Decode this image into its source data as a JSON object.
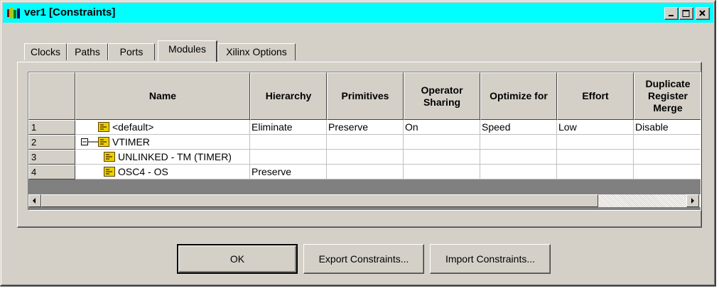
{
  "window": {
    "title": "ver1 [Constraints]"
  },
  "tabs": [
    "Clocks",
    "Paths",
    "Ports",
    "Modules",
    "Xilinx Options"
  ],
  "active_tab": "Modules",
  "table": {
    "columns": [
      "Name",
      "Hierarchy",
      "Primitives",
      "Operator Sharing",
      "Optimize for",
      "Effort",
      "Duplicate Register Merge"
    ],
    "rows": [
      {
        "num": "1",
        "name": "<default>",
        "tree": "",
        "hierarchy": "Eliminate",
        "primitives": "Preserve",
        "sharing": "On",
        "optimize": "Speed",
        "effort": "Low",
        "dup": "Disable"
      },
      {
        "num": "2",
        "name": "VTIMER",
        "tree": "⊟",
        "hierarchy": "",
        "primitives": "",
        "sharing": "",
        "optimize": "",
        "effort": "",
        "dup": ""
      },
      {
        "num": "3",
        "name": "UNLINKED - TM (TIMER)",
        "tree": "",
        "hierarchy": "",
        "primitives": "",
        "sharing": "",
        "optimize": "",
        "effort": "",
        "dup": ""
      },
      {
        "num": "4",
        "name": "OSC4 - OS",
        "tree": "",
        "hierarchy": "Preserve",
        "primitives": "",
        "sharing": "",
        "optimize": "",
        "effort": "",
        "dup": ""
      }
    ]
  },
  "buttons": {
    "ok": "OK",
    "export": "Export Constraints...",
    "import": "Import Constraints..."
  },
  "icons": {
    "app": "constraints-app-icon",
    "module": "module-icon",
    "minimize": "minimize-icon",
    "maximize": "maximize-icon",
    "close": "close-icon"
  },
  "colors": {
    "titlebar": "#00ffff",
    "face": "#d4d0c8",
    "module_icon": "#e8d000"
  }
}
